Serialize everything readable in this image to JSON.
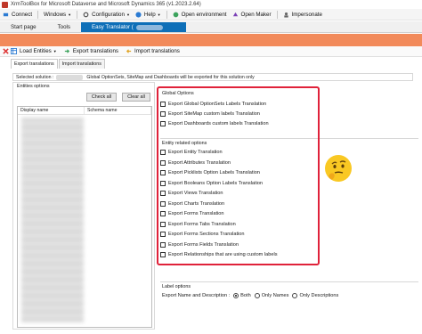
{
  "window": {
    "title": "XrmToolBox for Microsoft Dataverse and Microsoft Dynamics 365 (v1.2023.2.64)"
  },
  "menubar": {
    "connect": "Connect",
    "windows": "Windows",
    "configuration": "Configuration",
    "help": "Help",
    "open_environment": "Open environment",
    "open_maker": "Open Maker",
    "impersonate": "Impersonate"
  },
  "doc_tabs": {
    "start_page": "Start page",
    "tools": "Tools",
    "active": "Easy Translator ("
  },
  "toolbar": {
    "load_entities": "Load Entities",
    "export_translations": "Export translations",
    "import_translations": "Import translations"
  },
  "inner_tabs": {
    "export": "Export translations",
    "import": "Import translations"
  },
  "solution_bar": {
    "label": "Selected solution :",
    "message": "Global OptionSets, SiteMap and Dashboards will be exported for this solution only"
  },
  "entities": {
    "legend": "Entities options",
    "check_all": "Check all",
    "clear_all": "Clear all",
    "columns": [
      "Display name",
      "Schema name"
    ]
  },
  "global_options": {
    "legend": "Global Options",
    "items": [
      "Export Global OptionSets Labels Translation",
      "Export SiteMap custom labels Translation",
      "Export Dashboards custom labels Translation"
    ]
  },
  "entity_options": {
    "legend": "Entity related options",
    "items": [
      "Export Entity Translation",
      "Export Attributes Translation",
      "Export Picklists Option Labels Translation",
      "Export Booleans Option Labels Translation",
      "Export Views Translation",
      "Export Charts Translation",
      "Export Forms Translation",
      "Export Forms Tabs Translation",
      "Export Forms Sections Translation",
      "Export Forms Fields Translation",
      "Export Relationships that are using custom labels"
    ]
  },
  "label_options": {
    "legend": "Label options",
    "export_label": "Export Name and Description :",
    "radios": [
      {
        "label": "Both",
        "selected": true
      },
      {
        "label": "Only Names",
        "selected": false
      },
      {
        "label": "Only Descriptions",
        "selected": false
      }
    ]
  },
  "colors": {
    "accent_blue": "#0e6fb8",
    "orange_band": "#f28a5a",
    "highlight_red": "#e0223a"
  }
}
